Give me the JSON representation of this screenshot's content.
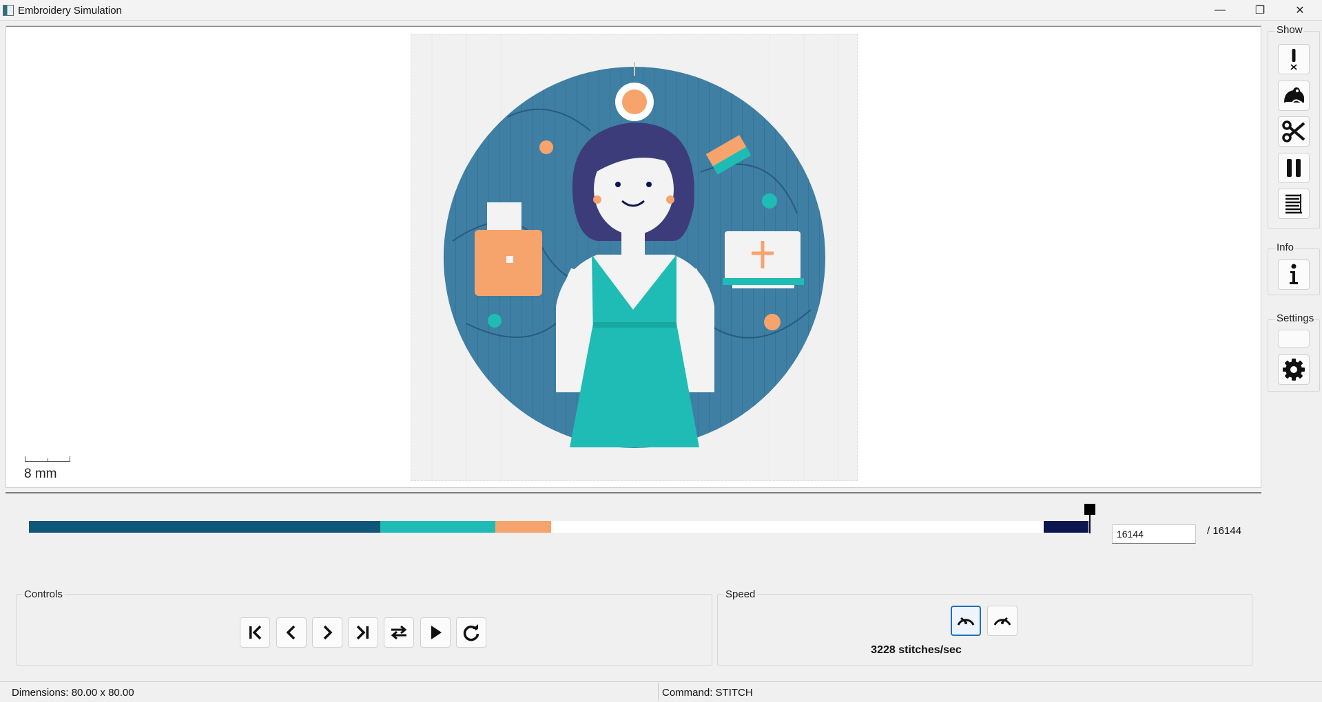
{
  "window": {
    "title": "Embroidery Simulation",
    "minimize_glyph": "—",
    "maximize_glyph": "❐",
    "close_glyph": "✕"
  },
  "canvas": {
    "scale_label": "8 mm"
  },
  "timeline": {
    "current_stitch": "16144",
    "total_label": "/ 16144",
    "progress": 1.0,
    "segment_colors": [
      "#0f5678",
      "#1ebcb4",
      "#f6a46c",
      "#ffffff",
      "#0c1750"
    ]
  },
  "controls": {
    "legend": "Controls",
    "buttons": [
      {
        "name": "first-stitch-icon"
      },
      {
        "name": "previous-icon"
      },
      {
        "name": "next-icon"
      },
      {
        "name": "last-stitch-icon"
      },
      {
        "name": "swap-direction-icon"
      },
      {
        "name": "play-icon"
      },
      {
        "name": "restart-icon"
      }
    ]
  },
  "speed": {
    "legend": "Speed",
    "value_label": "3228 stitches/sec",
    "buttons": [
      {
        "name": "slow-down-gauge-icon",
        "active": true
      },
      {
        "name": "speed-up-gauge-icon",
        "active": false
      }
    ]
  },
  "sidebar": {
    "show_label": "Show",
    "info_label": "Info",
    "settings_label": "Settings",
    "show_buttons": [
      "jump-warning-icon",
      "frog-icon",
      "scissors-icon",
      "pause-icon",
      "command-list-icon"
    ],
    "info_buttons": [
      "info-icon"
    ],
    "settings_buttons": [
      "gear-icon"
    ]
  },
  "status": {
    "dimensions": "Dimensions: 80.00 x 80.00",
    "command": "Command: STITCH"
  },
  "colors": {
    "dark_blue": "#0f5678",
    "teal": "#1ebcb4",
    "peach": "#f6a46c",
    "navy": "#0c1750",
    "hair": "#3d3c7a",
    "selection_blue": "#1f6fb8"
  }
}
